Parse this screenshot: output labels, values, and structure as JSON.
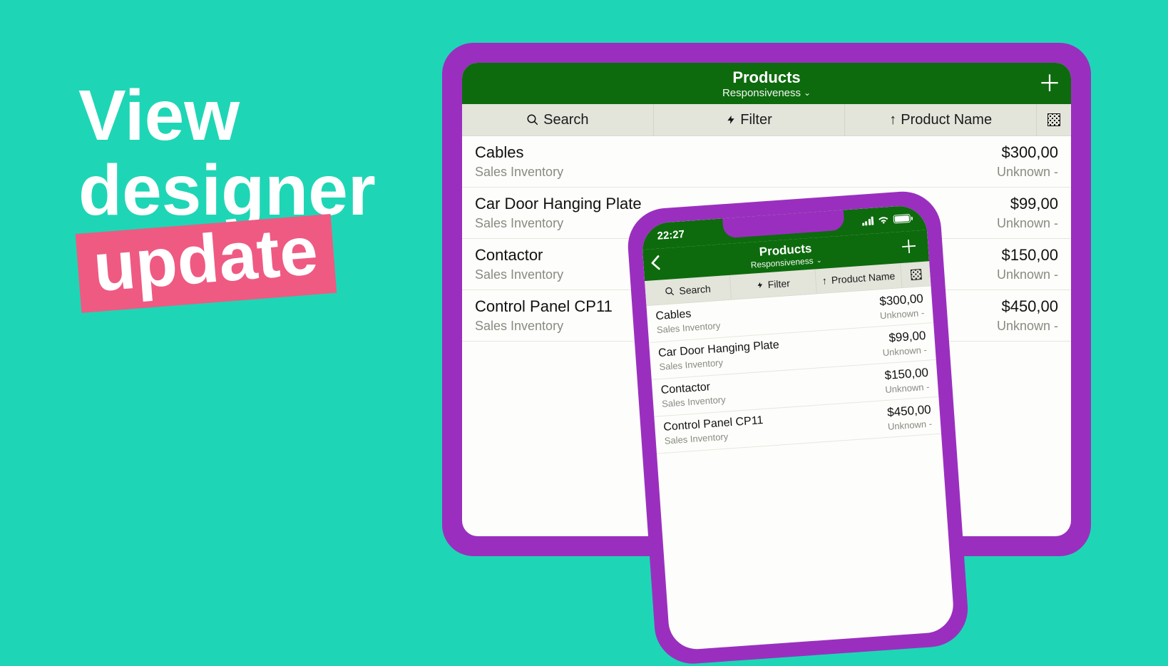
{
  "headline": {
    "line1": "View",
    "line2": "designer",
    "badge": "update"
  },
  "phone_status": {
    "time": "22:27"
  },
  "app": {
    "title": "Products",
    "subtitle": "Responsiveness"
  },
  "toolbar": {
    "search": "Search",
    "filter": "Filter",
    "sort": "Product Name"
  },
  "products": [
    {
      "name": "Cables",
      "category": "Sales Inventory",
      "price": "$300,00",
      "status": "Unknown -"
    },
    {
      "name": "Car Door Hanging Plate",
      "category": "Sales Inventory",
      "price": "$99,00",
      "status": "Unknown -"
    },
    {
      "name": "Contactor",
      "category": "Sales Inventory",
      "price": "$150,00",
      "status": "Unknown -"
    },
    {
      "name": "Control Panel CP11",
      "category": "Sales Inventory",
      "price": "$450,00",
      "status": "Unknown -"
    }
  ]
}
